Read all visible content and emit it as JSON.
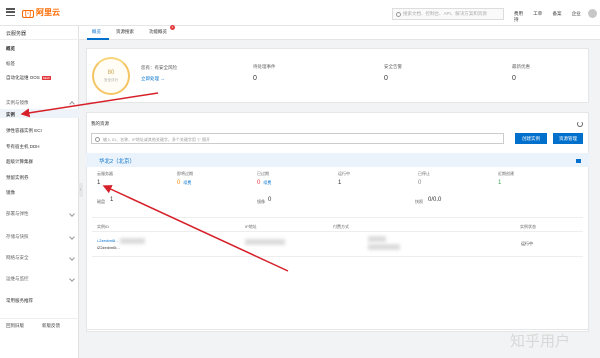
{
  "topbar": {
    "logo_text": "阿里云",
    "search_placeholder": "搜索文档、控制台、API、解决方案和资源",
    "links": [
      "费用",
      "工单",
      "备案",
      "企业",
      "支持"
    ]
  },
  "sidebar": {
    "title": "云服务器",
    "items": [
      {
        "label": "概览"
      },
      {
        "label": "标签"
      },
      {
        "label": "自动化运维 OOS"
      },
      {
        "label": "实例与镜像"
      },
      {
        "label": "实例"
      },
      {
        "label": "弹性容器实例 ECI"
      },
      {
        "label": "专有宿主机 DDH"
      },
      {
        "label": "超级计算集群"
      },
      {
        "label": "预留实例券"
      },
      {
        "label": "镜像"
      },
      {
        "label": "部署与弹性"
      },
      {
        "label": "存储与快照"
      },
      {
        "label": "网络与安全"
      },
      {
        "label": "运维与监控"
      },
      {
        "label": "常用服务推荐"
      }
    ],
    "new_badge": "NEW",
    "footer": [
      "回到旧版",
      "新版反馈"
    ]
  },
  "tabs": [
    {
      "label": "概览"
    },
    {
      "label": "资源搜索"
    },
    {
      "label": "功能概览"
    }
  ],
  "tab_badge": "1",
  "security": {
    "score": "80",
    "score_label": "安全评分",
    "risk_text": "您有：有安全风险",
    "fix_link": "立即处理 →"
  },
  "stats": [
    {
      "label": "待处理事件",
      "value": "0"
    },
    {
      "label": "安全告警",
      "value": "0"
    },
    {
      "label": "最新优惠",
      "value": "0"
    }
  ],
  "resources": {
    "title": "我的资源",
    "search_placeholder": "输入 ID、名称、IP地址或其他关键字，多个关键字用 \"|\" 隔开",
    "create_btn": "创建实例",
    "region_btn": "资源管理"
  },
  "region": {
    "title": "华北2（北京）",
    "metrics": [
      {
        "label": "云服务器",
        "value": "1",
        "sub": ""
      },
      {
        "label": "即将过期",
        "value": "0",
        "sub": "续费"
      },
      {
        "label": "已过期",
        "value": "0",
        "sub": "续费"
      },
      {
        "label": "运行中",
        "value": "1",
        "sub": ""
      },
      {
        "label": "已停止",
        "value": "0",
        "sub": ""
      },
      {
        "label": "近期创建",
        "value": "1",
        "sub": ""
      }
    ],
    "metrics2": [
      {
        "label": "磁盘",
        "value": "1"
      },
      {
        "label": "镜像",
        "value": "0"
      },
      {
        "label": "快照",
        "value": "0/0.0"
      }
    ],
    "table_headers": [
      "实例ID",
      "IP地址",
      "付费方式",
      "实例状态"
    ],
    "row": {
      "id": "i-2zedvn6i...",
      "name": "iZ2zedvn6i...",
      "status": "运行中"
    }
  },
  "watermark": "知乎用户"
}
